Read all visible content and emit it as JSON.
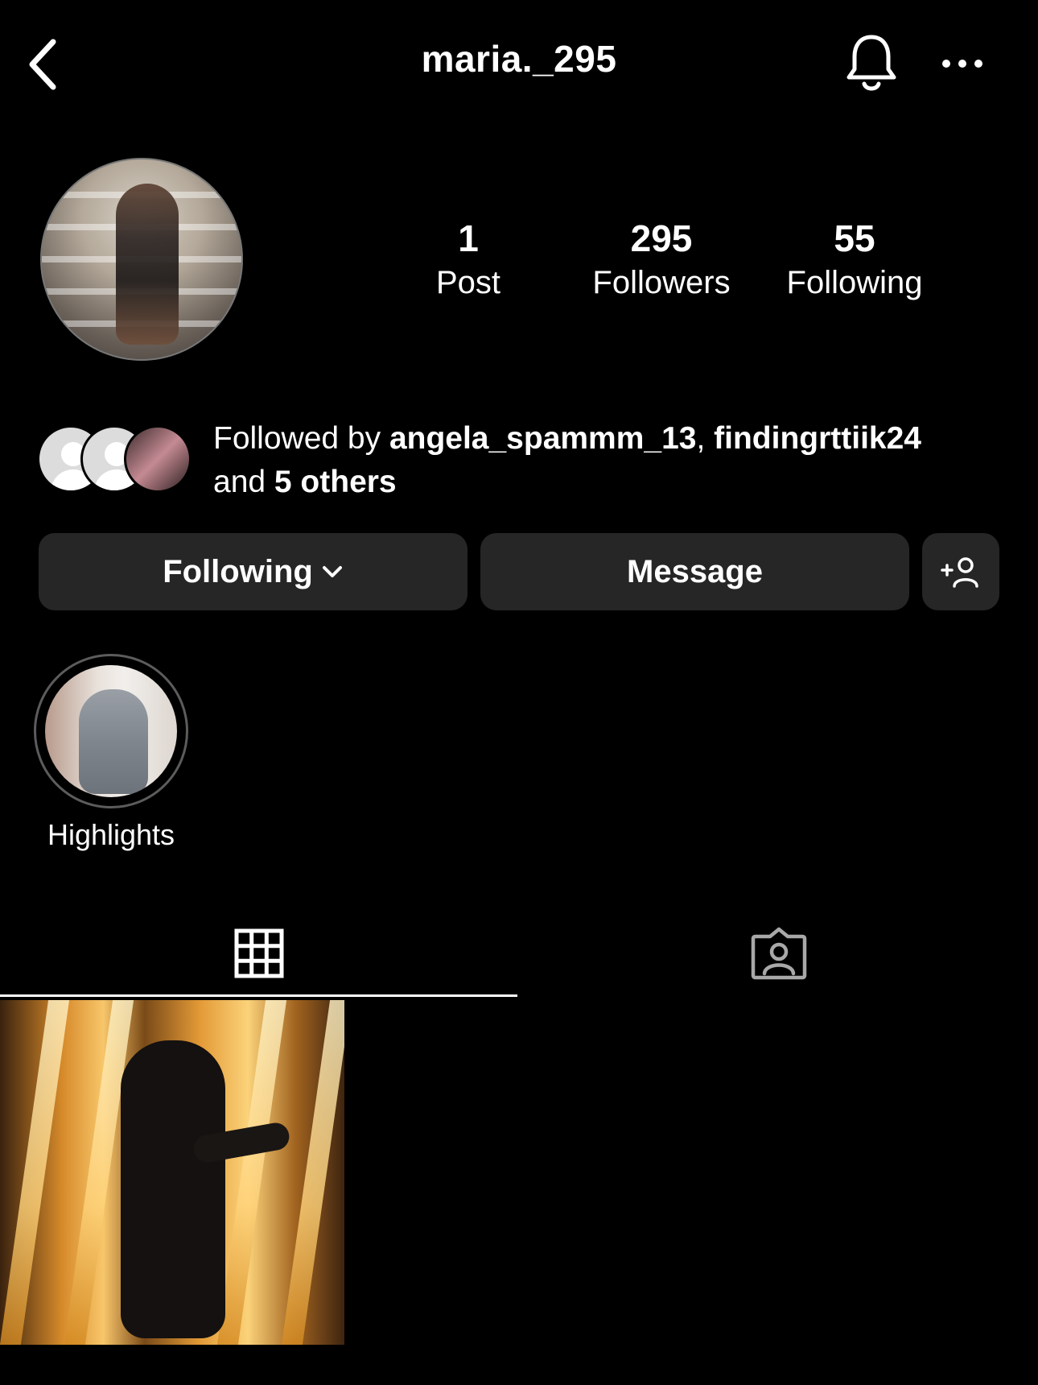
{
  "header": {
    "username": "maria._295",
    "back_icon": "chevron-left-icon",
    "notification_icon": "bell-icon",
    "more_icon": "ellipsis-icon"
  },
  "profile": {
    "avatar_icon": "profile-photo",
    "stats": [
      {
        "value": "1",
        "label": "Post"
      },
      {
        "value": "295",
        "label": "Followers"
      },
      {
        "value": "55",
        "label": "Following"
      }
    ]
  },
  "followed_by": {
    "prefix": "Followed by ",
    "user1": "angela_spammm_13",
    "separator": ", ",
    "user2": "findingrttiik24",
    "and_text": "and ",
    "others": "5 others"
  },
  "buttons": {
    "following": "Following",
    "message": "Message",
    "add_user_icon": "add-person-icon"
  },
  "highlights": [
    {
      "label": "Highlights"
    }
  ],
  "tabs": {
    "grid_icon": "grid-icon",
    "tagged_icon": "tagged-person-icon",
    "active": "grid"
  },
  "colors": {
    "background": "#000000",
    "button_bg": "#262626",
    "text": "#ffffff"
  }
}
